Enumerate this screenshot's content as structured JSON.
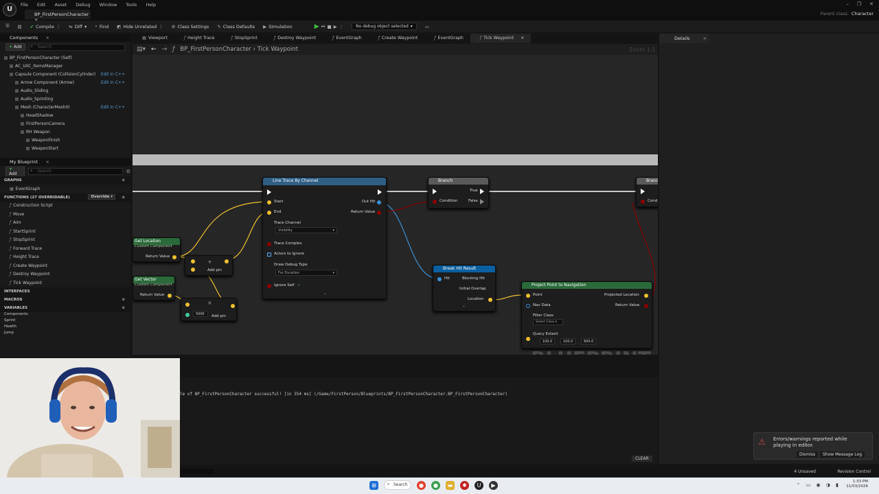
{
  "menu": [
    "File",
    "Edit",
    "Asset",
    "Debug",
    "Window",
    "Tools",
    "Help"
  ],
  "logo": "U",
  "doc_tab": "BP_FirstPersonCharacter",
  "window_controls": [
    "–",
    "❐",
    "✕"
  ],
  "parent_class": {
    "label": "Parent class:",
    "value": "Character"
  },
  "toolbar": {
    "compile": "Compile",
    "diff": "Diff",
    "find": "Find",
    "hide_unrelated": "Hide Unrelated",
    "class_settings": "Class Settings",
    "class_defaults": "Class Defaults",
    "simulation": "Simulation",
    "debug_object": "No debug object selected"
  },
  "components_panel": {
    "title": "Components",
    "add": "Add",
    "search": "Search",
    "items": [
      {
        "label": "BP_FirstPersonCharacter (Self)",
        "indent": 0,
        "edit": ""
      },
      {
        "label": "AC_UIIC_ItemsManager",
        "indent": 1,
        "edit": ""
      },
      {
        "label": "Capsule Component (CollisionCylinder)",
        "indent": 1,
        "edit": "Edit in C++"
      },
      {
        "label": "Arrow Component (Arrow)",
        "indent": 2,
        "edit": "Edit in C++"
      },
      {
        "label": "Audio_Sliding",
        "indent": 2,
        "edit": ""
      },
      {
        "label": "Audio_Sprinting",
        "indent": 2,
        "edit": ""
      },
      {
        "label": "Mesh (CharacterMesh0)",
        "indent": 2,
        "edit": "Edit in C++"
      },
      {
        "label": "HeadShadow",
        "indent": 3,
        "edit": ""
      },
      {
        "label": "FirstPersonCamera",
        "indent": 3,
        "edit": ""
      },
      {
        "label": "RH Weapon",
        "indent": 3,
        "edit": ""
      },
      {
        "label": "WeaponFinish",
        "indent": 4,
        "edit": ""
      },
      {
        "label": "WeaponStart",
        "indent": 4,
        "edit": ""
      }
    ]
  },
  "my_blueprint": {
    "title": "My Blueprint",
    "add": "Add",
    "search": "Search",
    "graphs_label": "GRAPHS",
    "event_graph": "EventGraph",
    "functions_label": "FUNCTIONS (27 OVERRIDABLE)",
    "override": "Override",
    "functions": [
      "Construction Script",
      "Move",
      "Aim",
      "StartSprint",
      "StopSprint",
      "Forward Trace",
      "Height Trace",
      "Create Waypoint",
      "Destroy Waypoint",
      "Tick Waypoint"
    ],
    "interfaces": "INTERFACES",
    "macros": "MACROS",
    "variables": "VARIABLES",
    "var_items": [
      "Components",
      "Sprint",
      "Health",
      "Jump"
    ]
  },
  "graph_tabs": [
    {
      "label": "Viewport",
      "fn": false
    },
    {
      "label": "Height Trace",
      "fn": true
    },
    {
      "label": "StopSprint",
      "fn": true
    },
    {
      "label": "Destroy Waypoint",
      "fn": true
    },
    {
      "label": "EventGraph",
      "fn": true
    },
    {
      "label": "Create Waypoint",
      "fn": true
    },
    {
      "label": "EventGraph",
      "fn": true
    },
    {
      "label": "Tick Waypoint",
      "fn": true
    }
  ],
  "breadcrumb": "BP_FirstPersonCharacter  ›  Tick Waypoint",
  "zoom": "Zoom 1:1",
  "nodes": {
    "line_trace": {
      "title": "Line Trace By Channel",
      "start": "Start",
      "end": "End",
      "out_hit": "Out Hit",
      "return_value": "Return Value",
      "trace_channel": "Trace Channel",
      "channel_value": "Visibility",
      "trace_complex": "Trace Complex",
      "actors_ignore": "Actors to Ignore",
      "draw_debug": "Draw Debug Type",
      "debug_value": "For Duration",
      "ignore_self": "Ignore Self"
    },
    "branch": {
      "title": "Branch",
      "condition": "Condition",
      "true": "True",
      "false": "False"
    },
    "get_location": {
      "title": "Get Location",
      "sub": "Custom Component",
      "ret": "Return Value"
    },
    "get_vector": {
      "title": "Get Vector",
      "sub": "Custom Component",
      "ret": "Return Value"
    },
    "add1": {
      "label": "Add pin"
    },
    "add2": {
      "label": "Add pin",
      "value": "5000"
    },
    "break_hit": {
      "title": "Break Hit Result",
      "hit": "Hit",
      "blocking": "Blocking Hit",
      "initial": "Initial Overlap",
      "location": "Location"
    },
    "project": {
      "title": "Project Point to Navigation",
      "point": "Point",
      "nav": "Nav Data",
      "filter": "Filter Class",
      "filter_val": "Select Class",
      "extent": "Query Extent",
      "ex": "100.0",
      "ey": "100.0",
      "ez": "600.0",
      "projected": "Projected Location",
      "ret": "Return Value"
    },
    "edge_node": {
      "title": "Branch",
      "cond": "Cond"
    }
  },
  "watermark": "BLUEPRINT",
  "details": {
    "title": "Details"
  },
  "output_log": "le of BP_FirstPersonCharacter successful! [in 354 ms] (/Game/FirstPerson/Blueprints/BP_FirstPersonCharacter.BP_FirstPersonCharacter)",
  "clear": "CLEAR",
  "toast": {
    "message": "Errors/warnings reported while playing in editor.",
    "dismiss": "Dismiss",
    "show_log": "Show Message Log"
  },
  "status": {
    "unsaved": "4 Unsaved",
    "revision": "Revision Control"
  },
  "taskbar": {
    "search": "Search",
    "time": "1:33 PM",
    "date": "11/03/2026"
  },
  "colors": {
    "exec": "#ffffff",
    "vector": "#f0c030",
    "object": "#3a8fd6",
    "bool": "#8c0000",
    "struct": "#0a5fa0",
    "func_header": "#2f5f85",
    "pure_header": "#2a6a3a"
  }
}
